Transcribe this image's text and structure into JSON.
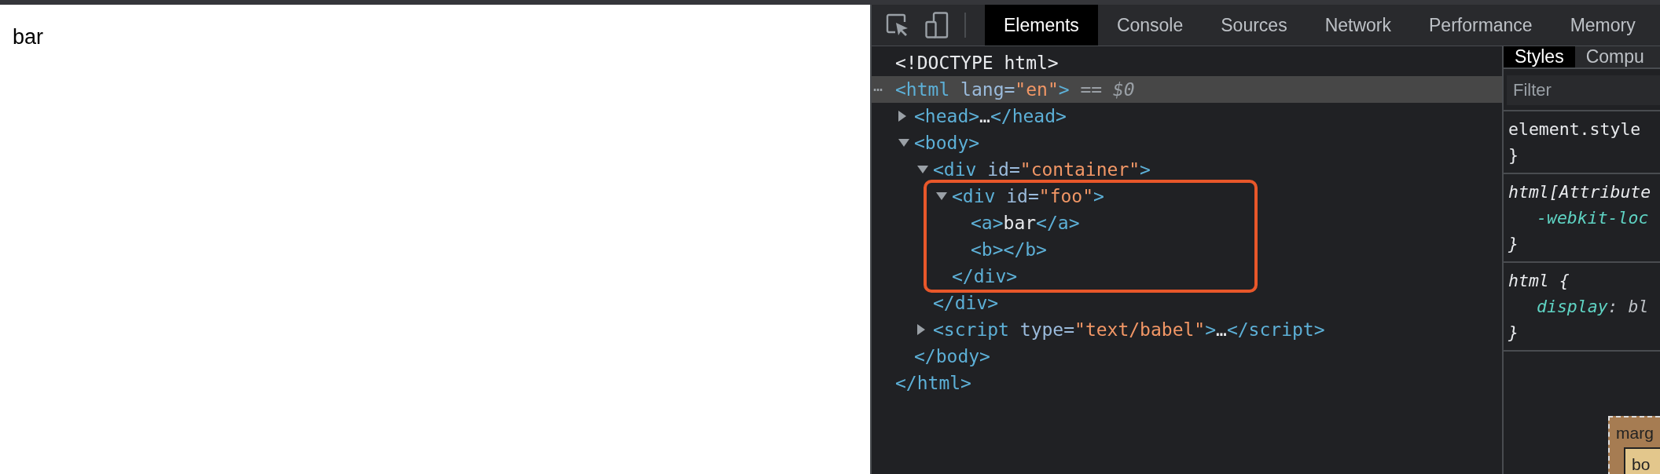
{
  "page": {
    "text": "bar"
  },
  "devtools": {
    "tabs": [
      {
        "label": "Elements",
        "selected": true
      },
      {
        "label": "Console",
        "selected": false
      },
      {
        "label": "Sources",
        "selected": false
      },
      {
        "label": "Network",
        "selected": false
      },
      {
        "label": "Performance",
        "selected": false
      },
      {
        "label": "Memory",
        "selected": false
      }
    ],
    "dom_tree": [
      {
        "selected": false,
        "highlighted": false,
        "line": [
          {
            "kind": "doctype",
            "text": "<!DOCTYPE html>"
          }
        ]
      },
      {
        "selected": true,
        "highlighted": false,
        "menu_glyph": "⋯",
        "line": [
          {
            "kind": "tag",
            "text": "<html"
          },
          {
            "kind": "attr",
            "text": " lang="
          },
          {
            "kind": "value",
            "text": "\"en\""
          },
          {
            "kind": "tag",
            "text": ">"
          },
          {
            "kind": "marker",
            "text": " == $0"
          }
        ],
        "children": [
          {
            "selected": false,
            "highlighted": false,
            "expanded": false,
            "line": [
              {
                "kind": "tag",
                "text": "<head>"
              },
              {
                "kind": "text",
                "text": "…"
              },
              {
                "kind": "tag",
                "text": "</head>"
              }
            ]
          },
          {
            "selected": false,
            "highlighted": false,
            "expanded": true,
            "line": [
              {
                "kind": "tag",
                "text": "<body>"
              }
            ],
            "children": [
              {
                "selected": false,
                "highlighted": false,
                "expanded": true,
                "line": [
                  {
                    "kind": "tag",
                    "text": "<div"
                  },
                  {
                    "kind": "attr",
                    "text": " id="
                  },
                  {
                    "kind": "value",
                    "text": "\"container\""
                  },
                  {
                    "kind": "tag",
                    "text": ">"
                  }
                ],
                "children": [
                  {
                    "selected": false,
                    "highlighted": true,
                    "expanded": true,
                    "line": [
                      {
                        "kind": "tag",
                        "text": "<div"
                      },
                      {
                        "kind": "attr",
                        "text": " id="
                      },
                      {
                        "kind": "value",
                        "text": "\"foo\""
                      },
                      {
                        "kind": "tag",
                        "text": ">"
                      }
                    ],
                    "children": [
                      {
                        "selected": false,
                        "highlighted": false,
                        "line": [
                          {
                            "kind": "tag",
                            "text": "<a>"
                          },
                          {
                            "kind": "text",
                            "text": "bar"
                          },
                          {
                            "kind": "tag",
                            "text": "</a>"
                          }
                        ]
                      },
                      {
                        "selected": false,
                        "highlighted": false,
                        "line": [
                          {
                            "kind": "tag",
                            "text": "<b></b>"
                          }
                        ]
                      }
                    ],
                    "close": [
                      {
                        "kind": "tag",
                        "text": "</div>"
                      }
                    ]
                  }
                ],
                "close": [
                  {
                    "kind": "tag",
                    "text": "</div>"
                  }
                ]
              },
              {
                "selected": false,
                "highlighted": false,
                "expanded": false,
                "line": [
                  {
                    "kind": "tag",
                    "text": "<script"
                  },
                  {
                    "kind": "attr",
                    "text": " type="
                  },
                  {
                    "kind": "value",
                    "text": "\"text/babel\""
                  },
                  {
                    "kind": "tag",
                    "text": ">"
                  },
                  {
                    "kind": "text",
                    "text": "…"
                  },
                  {
                    "kind": "tag",
                    "text": "</script>"
                  }
                ]
              }
            ],
            "close": [
              {
                "kind": "tag",
                "text": "</body>"
              }
            ]
          }
        ],
        "close": [
          {
            "kind": "tag",
            "text": "</html>"
          }
        ]
      }
    ],
    "styles_pane": {
      "tabs": [
        {
          "label": "Styles",
          "selected": true
        },
        {
          "label": "Compu",
          "selected": false
        }
      ],
      "filter": {
        "placeholder": "Filter"
      },
      "rules": [
        {
          "user_agent": false,
          "lines": [
            {
              "indent": false,
              "tokens": [
                {
                  "kind": "selector",
                  "text": "element.style"
                }
              ]
            },
            {
              "indent": false,
              "tokens": [
                {
                  "kind": "brace",
                  "text": "}"
                }
              ]
            }
          ]
        },
        {
          "user_agent": true,
          "lines": [
            {
              "indent": false,
              "tokens": [
                {
                  "kind": "selector",
                  "text": "html[Attribute"
                }
              ]
            },
            {
              "indent": true,
              "tokens": [
                {
                  "kind": "property",
                  "text": "-webkit-loc"
                }
              ]
            },
            {
              "indent": false,
              "tokens": [
                {
                  "kind": "brace",
                  "text": "}"
                }
              ]
            }
          ]
        },
        {
          "user_agent": true,
          "lines": [
            {
              "indent": false,
              "tokens": [
                {
                  "kind": "selector",
                  "text": "html {"
                }
              ]
            },
            {
              "indent": true,
              "tokens": [
                {
                  "kind": "property",
                  "text": "display"
                },
                {
                  "kind": "punct",
                  "text": ": "
                },
                {
                  "kind": "propvalue",
                  "text": "bl"
                }
              ]
            },
            {
              "indent": false,
              "tokens": [
                {
                  "kind": "brace",
                  "text": "}"
                }
              ]
            }
          ]
        }
      ],
      "box_model": {
        "margin_label": "marg",
        "border_label": "bo"
      }
    }
  }
}
